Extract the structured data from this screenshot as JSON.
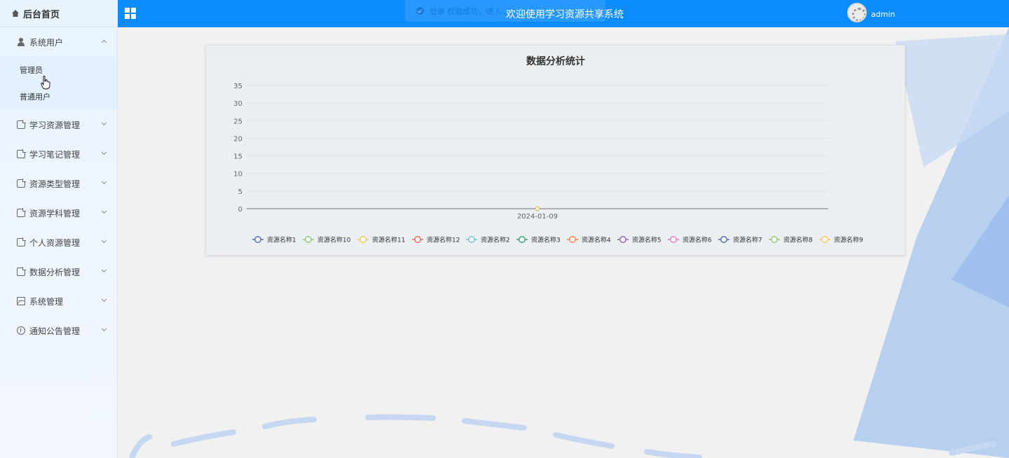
{
  "brand": {
    "label": "后台首页",
    "icon": "home-icon"
  },
  "header": {
    "title": "欢迎使用学习资源共享系统",
    "username": "admin",
    "toast": "登录 校验成功，进入..."
  },
  "sidebar": {
    "items": [
      {
        "label": "系统用户",
        "icon": "user-icon",
        "expanded": true,
        "children": [
          {
            "label": "管理员"
          },
          {
            "label": "普通用户"
          }
        ]
      },
      {
        "label": "学习资源管理",
        "icon": "document-icon"
      },
      {
        "label": "学习笔记管理",
        "icon": "document-icon"
      },
      {
        "label": "资源类型管理",
        "icon": "document-icon"
      },
      {
        "label": "资源学科管理",
        "icon": "document-icon"
      },
      {
        "label": "个人资源管理",
        "icon": "document-icon"
      },
      {
        "label": "数据分析管理",
        "icon": "document-icon"
      },
      {
        "label": "系统管理",
        "icon": "image-icon"
      },
      {
        "label": "通知公告管理",
        "icon": "info-icon"
      }
    ]
  },
  "colors": {
    "primary": "#0a8cff",
    "sidebar_bg": "#eaf4ff"
  },
  "chart_data": {
    "type": "line",
    "title": "数据分析统计",
    "xlabel": "",
    "ylabel": "",
    "categories": [
      "2024-01-09"
    ],
    "ylim": [
      0,
      35
    ],
    "yticks": [
      0,
      5,
      10,
      15,
      20,
      25,
      30,
      35
    ],
    "grid": true,
    "legend_position": "bottom",
    "series": [
      {
        "name": "资源名称1",
        "color": "#5470c6",
        "values": [
          0
        ]
      },
      {
        "name": "资源名称10",
        "color": "#91cc75",
        "values": [
          0
        ]
      },
      {
        "name": "资源名称11",
        "color": "#fac858",
        "values": [
          0
        ]
      },
      {
        "name": "资源名称12",
        "color": "#ee6666",
        "values": [
          0
        ]
      },
      {
        "name": "资源名称2",
        "color": "#73c0de",
        "values": [
          0
        ]
      },
      {
        "name": "资源名称3",
        "color": "#3ba272",
        "values": [
          0
        ]
      },
      {
        "name": "资源名称4",
        "color": "#fc8452",
        "values": [
          0
        ]
      },
      {
        "name": "资源名称5",
        "color": "#9a60b4",
        "values": [
          0
        ]
      },
      {
        "name": "资源名称6",
        "color": "#ea7ccc",
        "values": [
          0
        ]
      },
      {
        "name": "资源名称7",
        "color": "#5470c6",
        "values": [
          0
        ]
      },
      {
        "name": "资源名称8",
        "color": "#91cc75",
        "values": [
          0
        ]
      },
      {
        "name": "资源名称9",
        "color": "#fac858",
        "values": [
          0
        ]
      }
    ]
  }
}
